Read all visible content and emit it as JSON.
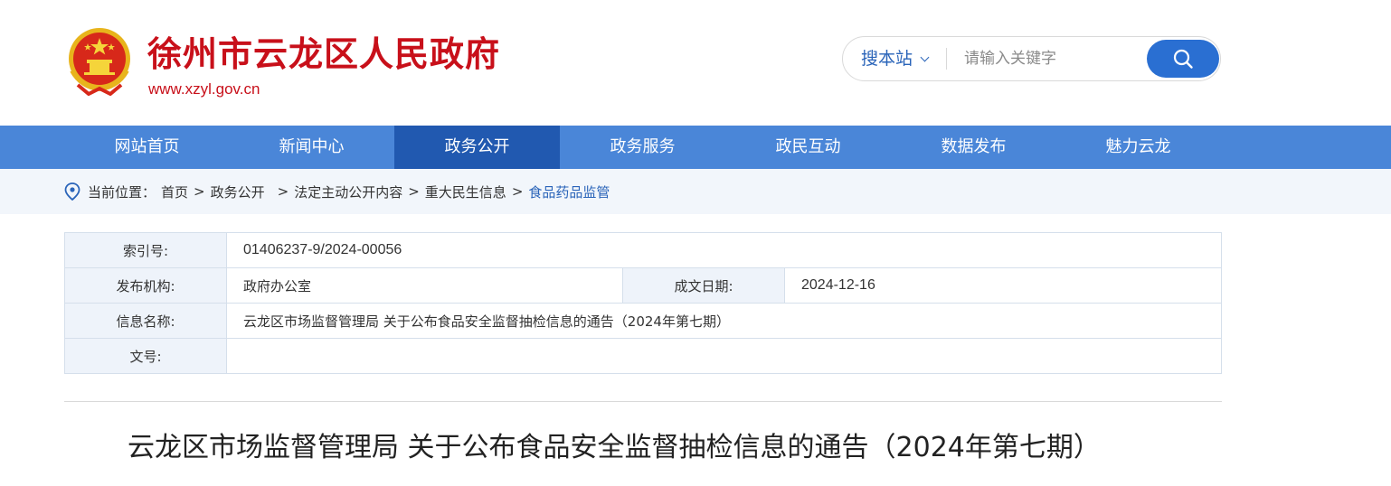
{
  "header": {
    "title": "徐州市云龙区人民政府",
    "url": "www.xzyl.gov.cn",
    "emblem_icon": "national-emblem-icon",
    "brand_color": "#c8101a"
  },
  "search": {
    "scope_label": "搜本站",
    "placeholder": "请输入关键字",
    "button_icon": "search-icon",
    "accent_color": "#2a6fd2"
  },
  "nav": {
    "items": [
      {
        "label": "网站首页"
      },
      {
        "label": "新闻中心"
      },
      {
        "label": "政务公开",
        "active": true
      },
      {
        "label": "政务服务"
      },
      {
        "label": "政民互动"
      },
      {
        "label": "数据发布"
      },
      {
        "label": "魅力云龙"
      }
    ],
    "bg_color": "#4a86d8",
    "active_color": "#2159b0"
  },
  "breadcrumb": {
    "prefix": "当前位置：",
    "items": [
      "首页",
      "政务公开",
      "法定主动公开内容",
      "重大民生信息",
      "食品药品监管"
    ],
    "separator": ">"
  },
  "meta": {
    "index_label": "索引号:",
    "index_value": "01406237-9/2024-00056",
    "publisher_label": "发布机构:",
    "publisher_value": "政府办公室",
    "date_label": "成文日期:",
    "date_value": "2024-12-16",
    "name_label": "信息名称:",
    "name_value": "云龙区市场监督管理局 关于公布食品安全监督抽检信息的通告（2024年第七期）",
    "doc_no_label": "文号:",
    "doc_no_value": ""
  },
  "article": {
    "title": "云龙区市场监督管理局 关于公布食品安全监督抽检信息的通告（2024年第七期）"
  }
}
